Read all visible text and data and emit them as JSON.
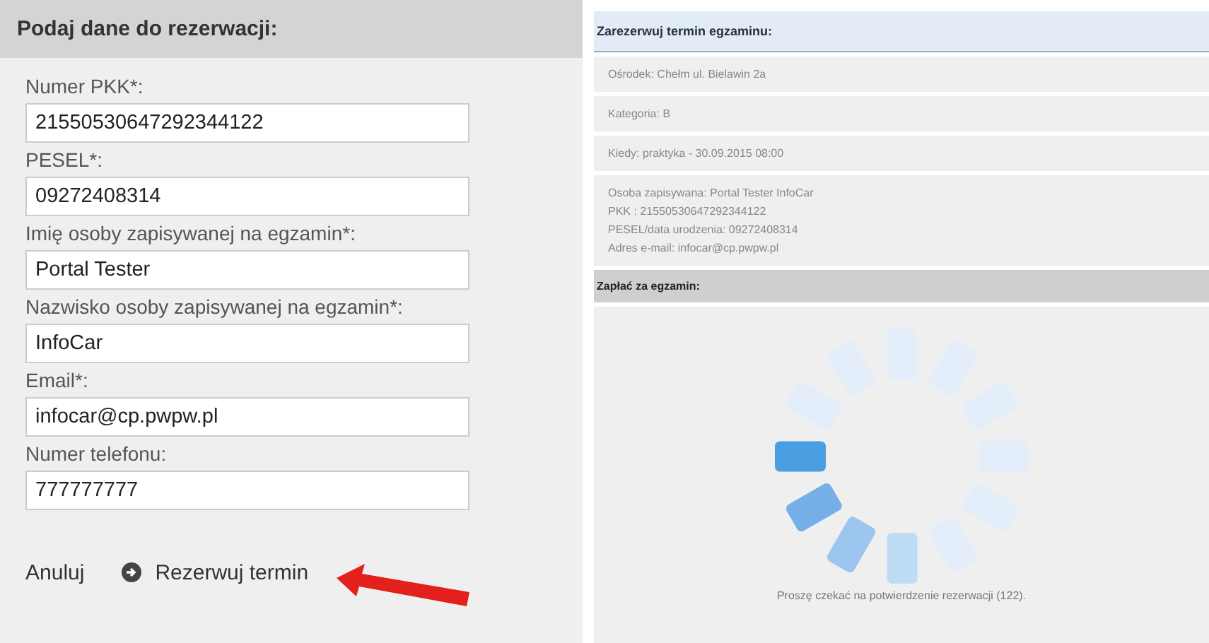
{
  "form": {
    "title": "Podaj dane do rezerwacji:",
    "fields": [
      {
        "label": "Numer PKK*:",
        "value": "21550530647292344122"
      },
      {
        "label": "PESEL*:",
        "value": "09272408314"
      },
      {
        "label": "Imię osoby zapisywanej na egzamin*:",
        "value": "Portal Tester"
      },
      {
        "label": "Nazwisko osoby zapisywanej na egzamin*:",
        "value": "InfoCar"
      },
      {
        "label": "Email*:",
        "value": "infocar@cp.pwpw.pl"
      },
      {
        "label": "Numer telefonu:",
        "value": "777777777"
      }
    ],
    "cancel": "Anuluj",
    "submit": "Rezerwuj termin"
  },
  "summary": {
    "title": "Zarezerwuj termin egzaminu:",
    "rows": [
      [
        "Ośrodek: Chełm ul. Bielawin 2a"
      ],
      [
        "Kategoria: B"
      ],
      [
        "Kiedy: praktyka - 30.09.2015 08:00"
      ],
      [
        "Osoba zapisywana: Portal Tester InfoCar",
        "PKK : 21550530647292344122",
        "PESEL/data urodzenia: 09272408314",
        "Adres e-mail: infocar@cp.pwpw.pl"
      ]
    ]
  },
  "payment": {
    "title": "Zapłać za egzamin:",
    "message": "Proszę czekać na potwierdzenie rezerwacji (122)."
  }
}
